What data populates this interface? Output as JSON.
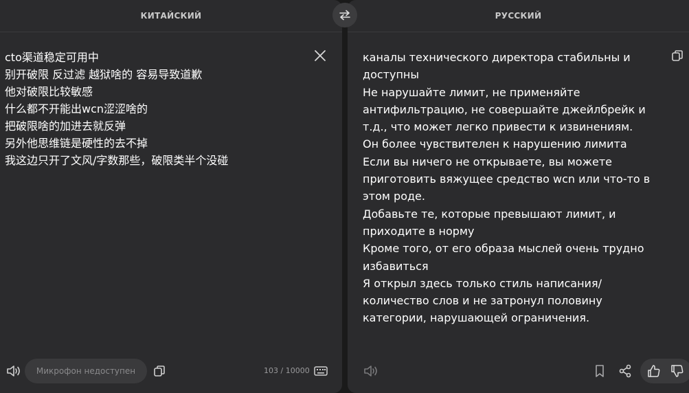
{
  "source": {
    "language_label": "КИТАЙСКИЙ",
    "text": "cto渠道稳定可用中\n别开破限 反过滤 越狱啥的 容易导致道歉\n他对破限比较敏感\n什么都不开能出wcn涩涩啥的\n把破限啥的加进去就反弹\n另外他思维链是硬性的去不掉\n我这边只开了文风/字数那些，破限类半个没碰",
    "mic_label": "Микрофон недоступен",
    "char_count": "103 / 10000"
  },
  "target": {
    "language_label": "РУССКИЙ",
    "text": "каналы технического директора стабильны и\nдоступны\nНе нарушайте лимит, не применяйте\nантифильтрацию, не совершайте джейлбрейк и\nт.д., что может легко привести к извинениям.\nОн более чувствителен к нарушению лимита\nЕсли вы ничего не открываете, вы можете\nприготовить вяжущее средство wcn или что-то в\nэтом роде.\nДобавьте те, которые превышают лимит, и\nприходите в норму\nКроме того, от его образа мыслей очень трудно\nизбавиться\nЯ открыл здесь только стиль написания/\nколичество слов и не затронул половину\nкатегории, нарушающей ограничения."
  },
  "icons": {
    "swap": "swap-arrows-icon",
    "clear": "close-icon",
    "copy": "copy-icon",
    "speaker": "speaker-icon",
    "keyboard": "keyboard-icon",
    "bookmark": "bookmark-icon",
    "share": "share-icon",
    "thumb_up": "thumbs-up-icon",
    "thumb_down": "thumbs-down-icon"
  },
  "colors": {
    "background": "#1a1a1a",
    "panel": "#2b2b2d",
    "pill": "#3a3a3c",
    "text": "#ffffff",
    "muted": "#8a8a8c"
  }
}
